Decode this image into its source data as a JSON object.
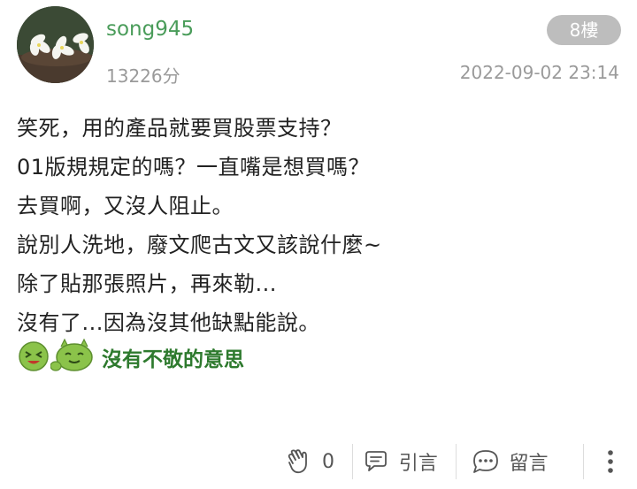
{
  "post": {
    "username": "song945",
    "score": "13226分",
    "floor": "8樓",
    "timestamp": "2022-09-02 23:14",
    "lines": [
      "笑死，用的產品就要買股票支持？",
      "01版規規定的嗎？一直嘴是想買嗎？",
      "去買啊，又沒人阻止。",
      "說別人洗地，廢文爬古文又該說什麼~",
      "除了貼那張照片，再來勒...",
      "沒有了...因為沒其他缺點能說。"
    ],
    "sticker_caption": "沒有不敬的意思"
  },
  "actions": {
    "like_count": "0",
    "quote_label": "引言",
    "comment_label": "留言"
  },
  "colors": {
    "username": "#4a9c5a",
    "badge_bg": "#bdbdbd",
    "meta_text": "#9a9a9a",
    "sticker_green": "#8bc34a"
  }
}
